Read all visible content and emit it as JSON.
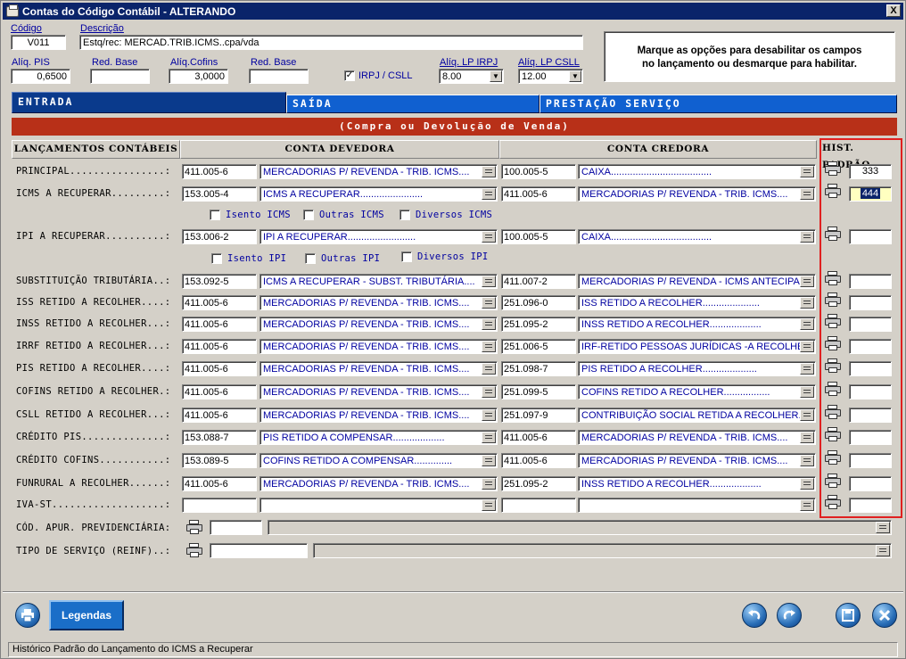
{
  "window": {
    "title": "Contas do Código Contábil  -  ALTERANDO",
    "close_label": "X"
  },
  "top": {
    "codigo_label": "Código",
    "codigo_value": "V011",
    "descricao_label": "Descrição",
    "descricao_value": "Estq/rec: MERCAD.TRIB.ICMS..cpa/vda",
    "aliq_pis_label": "Alíq. PIS",
    "aliq_pis_value": "0,6500",
    "red_base1_label": "Red. Base",
    "red_base1_value": "",
    "aliq_cofins_label": "Alíq.Cofins",
    "aliq_cofins_value": "3,0000",
    "red_base2_label": "Red. Base",
    "red_base2_value": "",
    "irpj_label": "IRPJ / CSLL",
    "irpj_checked": "✓",
    "aliq_lp_irpj_label": "Alíq. LP IRPJ",
    "aliq_lp_irpj_value": "8.00",
    "aliq_lp_csll_label": "Alíq. LP CSLL",
    "aliq_lp_csll_value": "12.00",
    "info_line1": "Marque as opções para desabilitar os campos",
    "info_line2": "no lançamento ou desmarque para habilitar."
  },
  "tabs": [
    "ENTRADA",
    "SAÍDA",
    "PRESTAÇÃO SERVIÇO"
  ],
  "banner": "(Compra ou Devolução de Venda)",
  "headers": {
    "lancamentos": "LANÇAMENTOS CONTÁBEIS",
    "devedora": "CONTA DEVEDORA",
    "credora": "CONTA CREDORA",
    "hist": "HIST. PADRÃO"
  },
  "rows": [
    {
      "label": "PRINCIPAL................:",
      "dcode": "411.005-6",
      "ddesc": "MERCADORIAS P/ REVENDA - TRIB. ICMS....",
      "ccode": "100.005-5",
      "cdesc": "CAIXA.....................................",
      "hist": "333"
    },
    {
      "label": "ICMS A RECUPERAR.........:",
      "dcode": "153.005-4",
      "ddesc": "ICMS A RECUPERAR.......................",
      "ccode": "411.005-6",
      "cdesc": "MERCADORIAS P/ REVENDA - TRIB. ICMS....",
      "hist": "444"
    },
    {
      "label": "IPI A RECUPERAR..........:",
      "dcode": "153.006-2",
      "ddesc": "IPI A RECUPERAR.........................",
      "ccode": "100.005-5",
      "cdesc": "CAIXA.....................................",
      "hist": ""
    },
    {
      "label": "SUBSTITUIÇÃO TRIBUTÁRIA..:",
      "dcode": "153.092-5",
      "ddesc": "ICMS A RECUPERAR - SUBST. TRIBUTÁRIA....",
      "ccode": "411.007-2",
      "cdesc": "MERCADORIAS P/ REVENDA - ICMS ANTECIPADO",
      "hist": ""
    },
    {
      "label": "ISS RETIDO A RECOLHER....:",
      "dcode": "411.005-6",
      "ddesc": "MERCADORIAS P/ REVENDA - TRIB. ICMS....",
      "ccode": "251.096-0",
      "cdesc": "ISS RETIDO A RECOLHER.....................",
      "hist": ""
    },
    {
      "label": "INSS RETIDO A RECOLHER...:",
      "dcode": "411.005-6",
      "ddesc": "MERCADORIAS P/ REVENDA - TRIB. ICMS....",
      "ccode": "251.095-2",
      "cdesc": "INSS RETIDO A RECOLHER...................",
      "hist": ""
    },
    {
      "label": "IRRF RETIDO A RECOLHER...:",
      "dcode": "411.005-6",
      "ddesc": "MERCADORIAS P/ REVENDA - TRIB. ICMS....",
      "ccode": "251.006-5",
      "cdesc": "IRF-RETIDO PESSOAS JURÍDICAS -A RECOLHER",
      "hist": ""
    },
    {
      "label": "PIS RETIDO A RECOLHER....:",
      "dcode": "411.005-6",
      "ddesc": "MERCADORIAS P/ REVENDA - TRIB. ICMS....",
      "ccode": "251.098-7",
      "cdesc": "PIS RETIDO A RECOLHER....................",
      "hist": ""
    },
    {
      "label": "COFINS RETIDO A RECOLHER.:",
      "dcode": "411.005-6",
      "ddesc": "MERCADORIAS P/ REVENDA - TRIB. ICMS....",
      "ccode": "251.099-5",
      "cdesc": "COFINS RETIDO A RECOLHER.................",
      "hist": ""
    },
    {
      "label": "CSLL RETIDO A RECOLHER...:",
      "dcode": "411.005-6",
      "ddesc": "MERCADORIAS P/ REVENDA - TRIB. ICMS....",
      "ccode": "251.097-9",
      "cdesc": "CONTRIBUIÇÃO SOCIAL RETIDA A RECOLHER...",
      "hist": ""
    },
    {
      "label": "CRÉDITO PIS..............:",
      "dcode": "153.088-7",
      "ddesc": "PIS RETIDO A COMPENSAR...................",
      "ccode": "411.005-6",
      "cdesc": "MERCADORIAS P/ REVENDA - TRIB. ICMS....",
      "hist": ""
    },
    {
      "label": "CRÉDITO COFINS...........:",
      "dcode": "153.089-5",
      "ddesc": "COFINS RETIDO A COMPENSAR..............",
      "ccode": "411.005-6",
      "cdesc": "MERCADORIAS P/ REVENDA - TRIB. ICMS....",
      "hist": ""
    },
    {
      "label": "FUNRURAL A RECOLHER......:",
      "dcode": "411.005-6",
      "ddesc": "MERCADORIAS P/ REVENDA - TRIB. ICMS....",
      "ccode": "251.095-2",
      "cdesc": "INSS RETIDO A RECOLHER...................",
      "hist": ""
    },
    {
      "label": "IVA-ST...................:",
      "dcode": "",
      "ddesc": "",
      "ccode": "",
      "cdesc": "",
      "hist": ""
    }
  ],
  "icms_checks": {
    "isento": "Isento ICMS",
    "outras": "Outras ICMS",
    "diversos": "Diversos ICMS"
  },
  "ipi_checks": {
    "isento": "Isento IPI",
    "outras": "Outras IPI",
    "diversos": "Diversos IPI"
  },
  "extra": {
    "cod_apur_label": "CÓD. APUR. PREVIDENCIÁRIA:",
    "tipo_servico_label": "TIPO DE SERVIÇO (REINF)..:"
  },
  "buttons": {
    "legendas": "Legendas"
  },
  "status": "Histórico Padrão do Lançamento do ICMS a Recuperar"
}
